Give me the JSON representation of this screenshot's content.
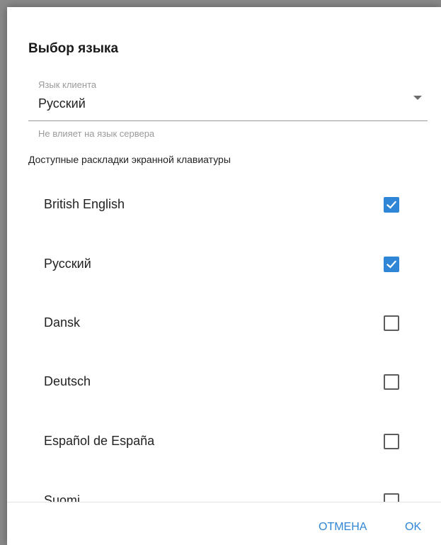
{
  "dialog": {
    "title": "Выбор языка",
    "client_language": {
      "label": "Язык клиента",
      "value": "Русский",
      "helper": "Не влияет на язык сервера"
    },
    "section_title": "Доступные раскладки экранной клавиатуры",
    "layouts": [
      {
        "label": "British English",
        "checked": true
      },
      {
        "label": "Русский",
        "checked": true
      },
      {
        "label": "Dansk",
        "checked": false
      },
      {
        "label": "Deutsch",
        "checked": false
      },
      {
        "label": "Español de España",
        "checked": false
      },
      {
        "label": "Suomi",
        "checked": false
      }
    ],
    "buttons": {
      "cancel": "ОТМЕНА",
      "ok": "OK"
    }
  },
  "colors": {
    "accent": "#2f86d6"
  },
  "icons": {
    "dropdown": "chevron-down-icon",
    "checked": "checkmark-icon"
  }
}
